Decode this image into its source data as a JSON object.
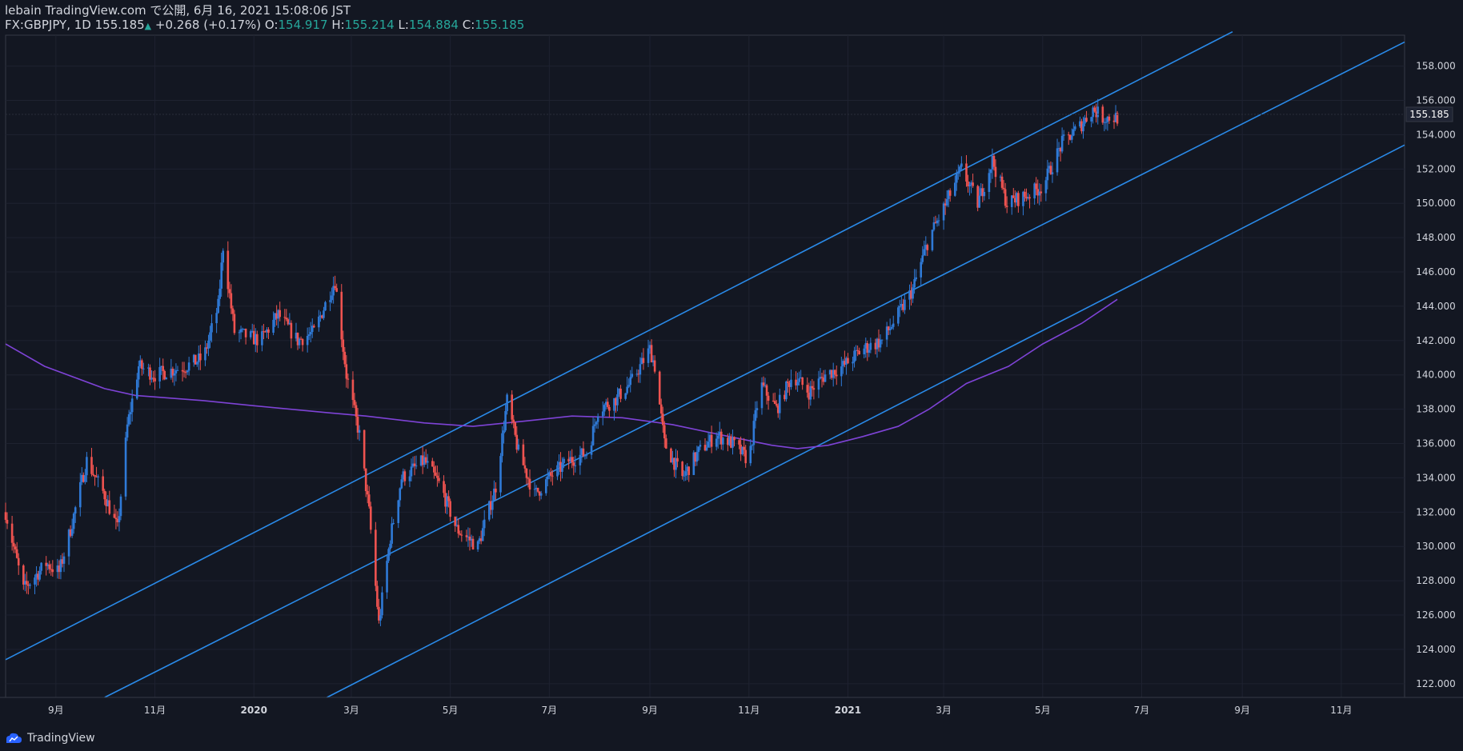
{
  "header": {
    "line1": "lebain TradingView.com で公開, 6月 16, 2021 15:08:06 JST",
    "symbol": "FX:GBPJPY, 1D",
    "last": "155.185",
    "change": "+0.268 (+0.17%)",
    "o_label": "O:",
    "o_value": "154.917",
    "h_label": "H:",
    "h_value": "155.214",
    "l_label": "L:",
    "l_value": "154.884",
    "c_label": "C:",
    "c_value": "155.185"
  },
  "footer": {
    "brand": "TradingView"
  },
  "colors": {
    "background": "#131722",
    "up": "#2f7ad7",
    "down": "#ef5350",
    "channel": "#2a8ae8",
    "ma": "#7e43d6",
    "grid": "#1e2230",
    "text": "#d1d4dc"
  },
  "chart_data": {
    "type": "candlestick",
    "symbol": "GBPJPY",
    "timeframe": "1D",
    "price_label": "155.185",
    "y_ticks": [
      "158.000",
      "156.000",
      "154.000",
      "152.000",
      "150.000",
      "148.000",
      "146.000",
      "144.000",
      "142.000",
      "140.000",
      "138.000",
      "136.000",
      "134.000",
      "132.000",
      "130.000",
      "128.000",
      "126.000",
      "124.000",
      "122.000"
    ],
    "ylim": [
      121.2,
      159.8
    ],
    "x_ticks": [
      {
        "label": "9月",
        "date": "2019-09-01"
      },
      {
        "label": "11月",
        "date": "2019-11-01"
      },
      {
        "label": "2020",
        "date": "2020-01-01"
      },
      {
        "label": "3月",
        "date": "2020-03-01"
      },
      {
        "label": "5月",
        "date": "2020-05-01"
      },
      {
        "label": "7月",
        "date": "2020-07-01"
      },
      {
        "label": "9月",
        "date": "2020-09-01"
      },
      {
        "label": "11月",
        "date": "2020-11-01"
      },
      {
        "label": "2021",
        "date": "2021-01-01"
      },
      {
        "label": "3月",
        "date": "2021-03-01"
      },
      {
        "label": "5月",
        "date": "2021-05-01"
      },
      {
        "label": "7月",
        "date": "2021-07-01"
      },
      {
        "label": "9月",
        "date": "2021-09-01"
      },
      {
        "label": "11月",
        "date": "2021-11-01"
      }
    ],
    "xlim": [
      "2019-08-01",
      "2021-12-10"
    ],
    "price_path": [
      [
        "2019-08-01",
        132.0
      ],
      [
        "2019-08-12",
        127.5
      ],
      [
        "2019-08-26",
        129.0
      ],
      [
        "2019-09-03",
        128.5
      ],
      [
        "2019-09-10",
        131.0
      ],
      [
        "2019-09-20",
        135.0
      ],
      [
        "2019-10-01",
        133.0
      ],
      [
        "2019-10-09",
        131.0
      ],
      [
        "2019-10-15",
        137.0
      ],
      [
        "2019-10-22",
        140.5
      ],
      [
        "2019-11-01",
        140.0
      ],
      [
        "2019-11-20",
        140.5
      ],
      [
        "2019-12-01",
        141.0
      ],
      [
        "2019-12-10",
        144.0
      ],
      [
        "2019-12-13",
        147.5
      ],
      [
        "2019-12-20",
        142.5
      ],
      [
        "2020-01-05",
        142.0
      ],
      [
        "2020-01-16",
        143.5
      ],
      [
        "2020-01-28",
        142.0
      ],
      [
        "2020-02-07",
        142.5
      ],
      [
        "2020-02-20",
        145.5
      ],
      [
        "2020-02-27",
        140.0
      ],
      [
        "2020-03-06",
        136.5
      ],
      [
        "2020-03-12",
        132.0
      ],
      [
        "2020-03-18",
        125.5
      ],
      [
        "2020-03-25",
        130.5
      ],
      [
        "2020-04-01",
        134.0
      ],
      [
        "2020-04-15",
        135.0
      ],
      [
        "2020-04-25",
        133.5
      ],
      [
        "2020-05-05",
        131.0
      ],
      [
        "2020-05-18",
        130.0
      ],
      [
        "2020-05-29",
        133.5
      ],
      [
        "2020-06-05",
        138.5
      ],
      [
        "2020-06-12",
        135.5
      ],
      [
        "2020-06-22",
        133.0
      ],
      [
        "2020-07-01",
        134.0
      ],
      [
        "2020-07-13",
        135.0
      ],
      [
        "2020-07-25",
        135.5
      ],
      [
        "2020-07-31",
        138.0
      ],
      [
        "2020-08-10",
        138.5
      ],
      [
        "2020-08-20",
        139.5
      ],
      [
        "2020-09-01",
        141.5
      ],
      [
        "2020-09-04",
        140.5
      ],
      [
        "2020-09-10",
        136.0
      ],
      [
        "2020-09-21",
        134.0
      ],
      [
        "2020-10-01",
        135.5
      ],
      [
        "2020-10-12",
        136.5
      ],
      [
        "2020-10-22",
        136.0
      ],
      [
        "2020-11-01",
        135.0
      ],
      [
        "2020-11-08",
        139.5
      ],
      [
        "2020-11-18",
        138.0
      ],
      [
        "2020-11-28",
        140.0
      ],
      [
        "2020-12-08",
        139.0
      ],
      [
        "2020-12-18",
        140.0
      ],
      [
        "2020-12-29",
        140.5
      ],
      [
        "2021-01-10",
        141.5
      ],
      [
        "2021-01-22",
        142.0
      ],
      [
        "2021-02-01",
        143.5
      ],
      [
        "2021-02-10",
        145.0
      ],
      [
        "2021-02-20",
        148.0
      ],
      [
        "2021-02-28",
        149.5
      ],
      [
        "2021-03-12",
        152.0
      ],
      [
        "2021-03-22",
        150.0
      ],
      [
        "2021-03-31",
        152.5
      ],
      [
        "2021-04-09",
        150.0
      ],
      [
        "2021-04-22",
        150.5
      ],
      [
        "2021-05-01",
        151.0
      ],
      [
        "2021-05-13",
        153.5
      ],
      [
        "2021-05-24",
        154.5
      ],
      [
        "2021-06-01",
        155.5
      ],
      [
        "2021-06-07",
        155.0
      ],
      [
        "2021-06-16",
        155.0
      ]
    ],
    "moving_average": [
      [
        "2019-08-01",
        141.8
      ],
      [
        "2019-08-25",
        140.5
      ],
      [
        "2019-10-01",
        139.2
      ],
      [
        "2019-10-20",
        138.8
      ],
      [
        "2019-12-01",
        138.5
      ],
      [
        "2020-01-01",
        138.2
      ],
      [
        "2020-02-15",
        137.8
      ],
      [
        "2020-03-10",
        137.6
      ],
      [
        "2020-04-15",
        137.2
      ],
      [
        "2020-05-15",
        137.0
      ],
      [
        "2020-06-15",
        137.3
      ],
      [
        "2020-07-15",
        137.6
      ],
      [
        "2020-08-15",
        137.5
      ],
      [
        "2020-09-15",
        137.1
      ],
      [
        "2020-10-15",
        136.5
      ],
      [
        "2020-11-15",
        135.9
      ],
      [
        "2020-12-01",
        135.7
      ],
      [
        "2020-12-20",
        135.9
      ],
      [
        "2021-01-10",
        136.4
      ],
      [
        "2021-02-01",
        137.0
      ],
      [
        "2021-02-20",
        138.0
      ],
      [
        "2021-03-15",
        139.5
      ],
      [
        "2021-04-10",
        140.5
      ],
      [
        "2021-05-01",
        141.8
      ],
      [
        "2021-05-25",
        143.0
      ],
      [
        "2021-06-16",
        144.4
      ]
    ],
    "channel_lines": [
      {
        "name": "upper",
        "from": [
          "2019-08-01",
          123.4
        ],
        "to": [
          "2021-08-26",
          160.0
        ]
      },
      {
        "name": "middle",
        "from": [
          "2019-10-01",
          121.2
        ],
        "to": [
          "2021-12-10",
          159.4
        ]
      },
      {
        "name": "lower",
        "from": [
          "2020-02-15",
          121.2
        ],
        "to": [
          "2021-12-10",
          153.4
        ]
      }
    ],
    "grid": true
  }
}
